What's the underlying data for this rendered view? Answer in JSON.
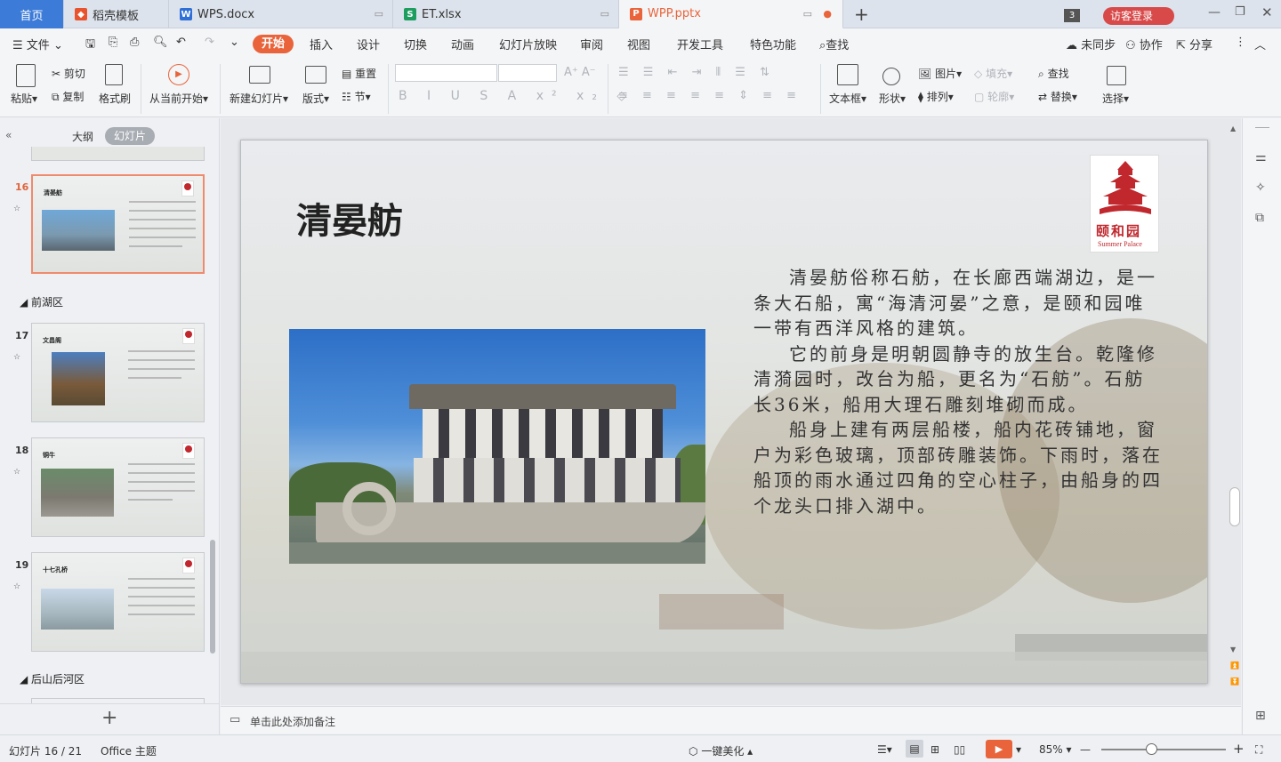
{
  "tabs": {
    "home": "首页",
    "template": "稻壳模板",
    "doc": "WPS.docx",
    "xls": "ET.xlsx",
    "ppt": "WPP.pptx",
    "count": "3",
    "login": "访客登录"
  },
  "menu": {
    "file": "文件",
    "items": [
      "开始",
      "插入",
      "设计",
      "切换",
      "动画",
      "幻灯片放映",
      "审阅",
      "视图",
      "开发工具",
      "特色功能"
    ],
    "search": "查找",
    "sync": "未同步",
    "collab": "协作",
    "share": "分享"
  },
  "ribbon": {
    "paste": "粘贴",
    "cut": "剪切",
    "copy": "复制",
    "format_painter": "格式刷",
    "from_current": "从当前开始",
    "new_slide": "新建幻灯片",
    "layout": "版式",
    "reset": "重置",
    "section": "节",
    "textbox": "文本框",
    "shape": "形状",
    "picture": "图片",
    "fill": "填充",
    "arrange": "排列",
    "outline": "轮廓",
    "find": "查找",
    "replace": "替换",
    "select": "选择"
  },
  "panel": {
    "outline_tab": "大纲",
    "slides_tab": "幻灯片",
    "section_front_lake": "前湖区",
    "section_back_hill": "后山后河区",
    "thumbs": [
      {
        "num": "16",
        "title": "清晏舫"
      },
      {
        "num": "17",
        "title": "文昌阁"
      },
      {
        "num": "18",
        "title": "铜牛"
      },
      {
        "num": "19",
        "title": "十七孔桥"
      }
    ]
  },
  "slide": {
    "title": "清晏舫",
    "logo_text": "颐和园",
    "logo_sub": "Summer Palace",
    "paragraphs": [
      "清晏舫俗称石舫，在长廊西端湖边，是一条大石船，寓“海清河晏”之意，是颐和园唯一带有西洋风格的建筑。",
      "它的前身是明朝圆静寺的放生台。乾隆修清漪园时，改台为船，更名为“石舫”。石舫长36米，船用大理石雕刻堆砌而成。",
      "船身上建有两层船楼，船内花砖铺地，窗户为彩色玻璃，顶部砖雕装饰。下雨时，落在船顶的雨水通过四角的空心柱子，由船身的四个龙头口排入湖中。"
    ]
  },
  "notes": {
    "placeholder": "单击此处添加备注"
  },
  "status": {
    "slide_counter": "幻灯片 16 / 21",
    "theme": "Office 主题",
    "beautify": "一键美化",
    "zoom": "85%"
  },
  "colors": {
    "accent": "#e9643b",
    "title_tab_active": "#ffffff"
  }
}
